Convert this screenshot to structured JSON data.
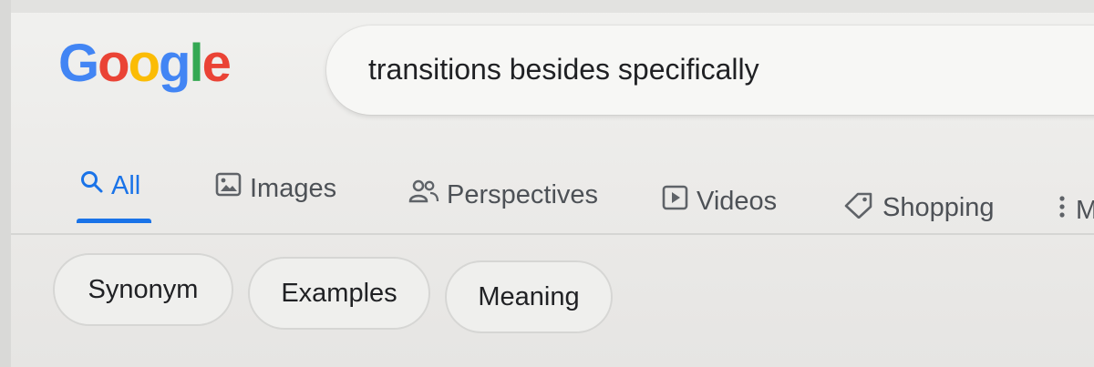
{
  "logo": {
    "letters": [
      "G",
      "o",
      "o",
      "g",
      "l",
      "e"
    ]
  },
  "search": {
    "query": "transitions besides specifically"
  },
  "tabs": [
    {
      "label": "All",
      "icon": "search-icon",
      "active": true
    },
    {
      "label": "Images",
      "icon": "image-icon"
    },
    {
      "label": "Perspectives",
      "icon": "people-icon"
    },
    {
      "label": "Videos",
      "icon": "play-icon"
    },
    {
      "label": "Shopping",
      "icon": "tag-icon"
    },
    {
      "label": "M",
      "icon": "more-vert-icon"
    }
  ],
  "chips": [
    {
      "label": "Synonym"
    },
    {
      "label": "Examples"
    },
    {
      "label": "Meaning"
    }
  ],
  "colors": {
    "accent": "#1a73e8",
    "g_blue": "#4285f4",
    "g_red": "#ea4335",
    "g_yellow": "#fbbc05",
    "g_green": "#34a853"
  }
}
